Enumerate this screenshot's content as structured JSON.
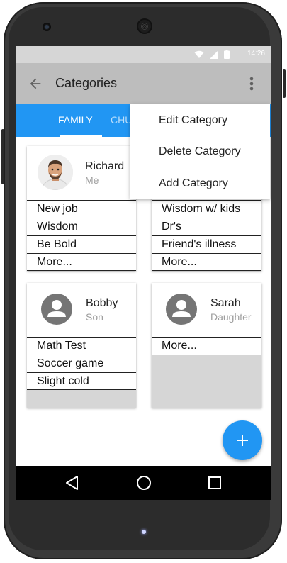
{
  "status": {
    "time": "14:26"
  },
  "appbar": {
    "title": "Categories"
  },
  "tabs": [
    {
      "label": "FAMILY",
      "active": true
    },
    {
      "label": "CHU",
      "active": false
    }
  ],
  "menu": {
    "items": [
      {
        "label": "Edit Category"
      },
      {
        "label": "Delete Category"
      },
      {
        "label": "Add Category"
      }
    ]
  },
  "cards": [
    {
      "name": "Richard",
      "relation": "Me",
      "avatar": "photo",
      "items": [
        "New job",
        "Wisdom",
        "Be Bold",
        "More..."
      ]
    },
    {
      "name": "",
      "relation": "",
      "avatar": "hidden",
      "items": [
        "Wisdom w/ kids",
        "Dr's",
        "Friend's illness",
        "More..."
      ]
    },
    {
      "name": "Bobby",
      "relation": "Son",
      "avatar": "person-icon",
      "items": [
        "Math Test",
        "Soccer game",
        "Slight cold"
      ]
    },
    {
      "name": "Sarah",
      "relation": "Daughter",
      "avatar": "person-icon",
      "items": [
        "More..."
      ]
    }
  ],
  "fab": {
    "icon": "plus-icon"
  },
  "navbar": {
    "icons": [
      "back-triangle-icon",
      "home-circle-icon",
      "recents-square-icon"
    ]
  },
  "colors": {
    "accent": "#2196f3",
    "appbar": "#bdbdbd",
    "statusbar": "#d6d6d6",
    "navbar": "#000000"
  }
}
